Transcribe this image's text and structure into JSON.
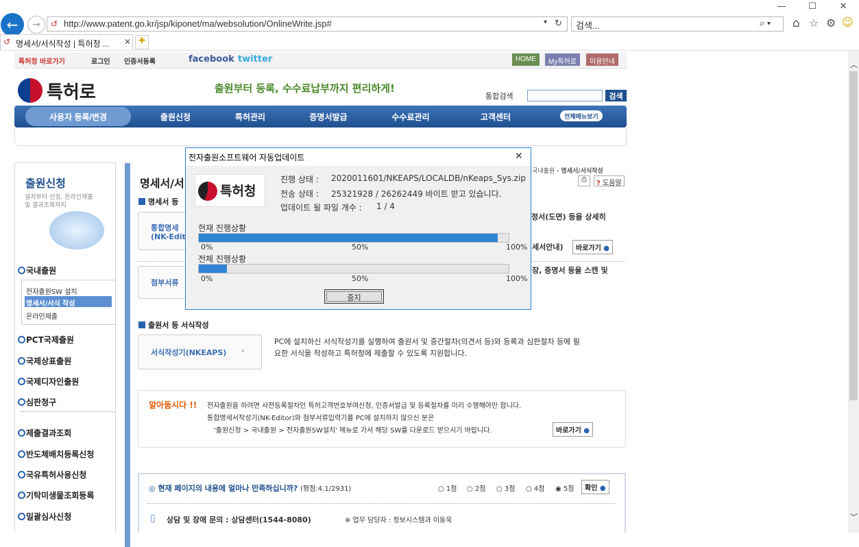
{
  "browser": {
    "url": "http://www.patent.go.kr/jsp/kiponet/ma/websolution/OnlineWrite.jsp#",
    "search_placeholder": "검색...",
    "tab_title": "명세서/서식작성 | 특허청 ..."
  },
  "site": {
    "top_links": [
      "특허청 바로가기",
      "로그인",
      "인증서등록"
    ],
    "social": [
      "facebook",
      "twitter"
    ],
    "top_buttons": [
      "HOME",
      "My특허로",
      "이용안내"
    ],
    "logo": "특허로",
    "slogan": "출원부터 등록, 수수료납부까지 편리하게!",
    "search_label": "통합검색",
    "search_button": "검색",
    "nav": [
      "사용자 등록/변경",
      "출원신청",
      "특허관리",
      "증명서발급",
      "수수료관리",
      "고객센터"
    ],
    "all_menu": "전체메뉴보기"
  },
  "left": {
    "title": "출원신청",
    "desc": "설치부터 신청, 온라인제출\n및 결과조회까지",
    "menu": [
      "국내출원",
      "PCT국제출원",
      "국제상표출원",
      "국제디자인출원",
      "심판청구",
      "제출결과조회",
      "반도체배치등록신청",
      "국유특허사용신청",
      "기탁미생물조회등록",
      "일괄심사신청"
    ],
    "submenu": [
      "전자출원SW 설치",
      "명세서/서식 작성",
      "온라인제출"
    ]
  },
  "content": {
    "breadcrumb_tail": "국내출원",
    "breadcrumb_current": "명세서/서식작성",
    "page_title": "명세서/서",
    "print_label": "",
    "help_label": "도움말",
    "sec1": "명세서 등",
    "box1_line1": "통합명세",
    "box1_line2": "(NK-Edit",
    "desc1": "정서(도면) 등을 상세히",
    "desc1b": "세서안내)",
    "go1": "바로가기",
    "box2": "첨부서류",
    "desc2": "장, 증명서 등을 스캔 및",
    "sec2": "출원서 등 서식작성",
    "box3": "서식작성기(NKEAPS)",
    "desc3_1": "PC에 설치하신 서식작성기를 실행하여 출원서 및 중간절차(의견서 등)와 등록과 심판절차 등에 필",
    "desc3_2": "요한 서식을 작성하고 특허청에 제출할 수 있도록 지원합니다.",
    "notice_title": "알아둡시다 !!",
    "notice1": "전자출원을 하려면 사전등록절차인 특허고객번호부여신청, 인증서발급 및 등록절차를 미리 수행해야만 합니다.",
    "notice2": "통합명세서작성기(NK-Editor)와 첨부서류입력기를 PC에 설치하지 않으신 분은",
    "notice3": "'출원신청 > 국내출원 > 전자출원SW설치' 메뉴로 가서 해당 SW를 다운로드 받으시기 바랍니다.",
    "go2": "바로가기",
    "survey_q": "현재 페이지의 내용에 얼마나 만족하십니까?",
    "survey_score": "(평점:4.1/2931)",
    "survey_opts": [
      "1점",
      "2점",
      "3점",
      "4점",
      "5점"
    ],
    "survey_btn": "확인",
    "contact": "상담 및 장애 문의 : 상담센터(1544-8080)",
    "contact2": "※ 업무 담당자 : 정보시스템과 이동욱"
  },
  "dialog": {
    "title": "전자출원소프트웨어 자동업데이트",
    "logo_text": "특허청",
    "status_label": "진행 상태 :",
    "status_value": "2020011601/NKEAPS/LOCALDB/nKeaps_Sys.zip",
    "transfer_label": "전송 상태 :",
    "transfer_value": "25321928 / 26262449 바이트 받고 있습니다.",
    "files_label": "업데이트 될 파일 개수 :",
    "files_value": "1 / 4",
    "current_label": "현재 진행상황",
    "current_progress": 0.964,
    "total_label": "전체 진행상황",
    "total_progress": 0.09,
    "tick0": "0%",
    "tick50": "50%",
    "tick100": "100%",
    "stop_button": "중지"
  }
}
